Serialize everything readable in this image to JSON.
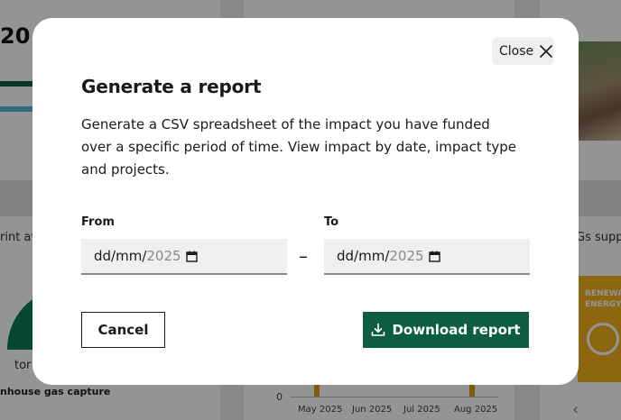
{
  "background": {
    "stat_number": "20",
    "left_label": "rint av",
    "right_label": "Gs suppo",
    "gauge_unit": "tor",
    "gauge_caption": "nhouse gas capture",
    "axis_zero": "0",
    "months": [
      "May 2025",
      "Jun 2025",
      "Jul 2025",
      "Aug 2025"
    ],
    "sdg_card": {
      "line1": "RENEWABL",
      "line2": "ENERGY"
    },
    "chevron": "‹"
  },
  "modal": {
    "close_label": "Close",
    "title": "Generate a report",
    "description": "Generate a CSV spreadsheet of the impact you have funded over a specific period of time. View impact by date, impact type and projects.",
    "from": {
      "label": "From",
      "value": "dd/mm/",
      "year": "2025"
    },
    "range_separator": "–",
    "to": {
      "label": "To",
      "value": "dd/mm/",
      "year": "2025"
    },
    "cancel_label": "Cancel",
    "download_label": "Download report"
  },
  "colors": {
    "primary": "#0e5c44",
    "input_bg": "#efefef",
    "overlay": "rgba(0,0,0,0.42)",
    "sdg_yellow": "#f2b21b"
  },
  "icons": [
    "close-icon",
    "calendar-icon",
    "download-icon",
    "chevron-left-icon",
    "sun-icon"
  ]
}
